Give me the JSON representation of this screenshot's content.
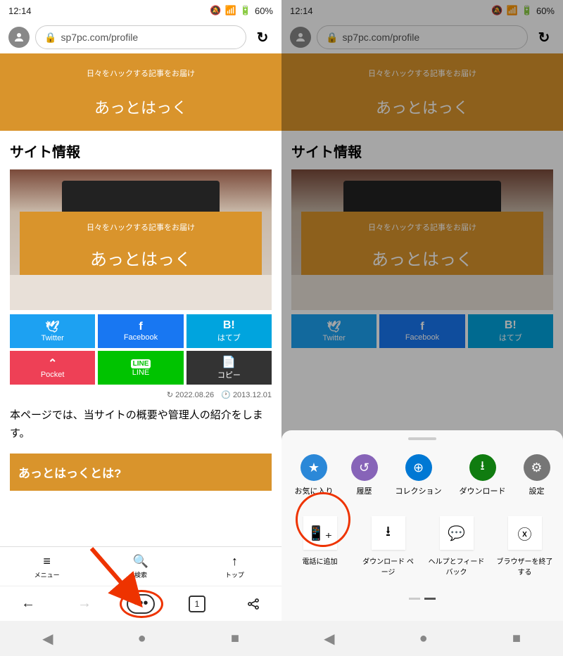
{
  "status": {
    "time": "12:14",
    "battery": "60%"
  },
  "url": "sp7pc.com/profile",
  "banner": {
    "sub": "日々をハックする記事をお届け",
    "title": "あっとはっく"
  },
  "section_title": "サイト情報",
  "hero": {
    "sub": "日々をハックする記事をお届け",
    "title": "あっとはっく"
  },
  "share": {
    "twitter": {
      "icon": "🐦",
      "label": "Twitter"
    },
    "facebook": {
      "icon": "f",
      "label": "Facebook"
    },
    "hatena": {
      "icon": "B!",
      "label": "はてブ"
    },
    "pocket": {
      "icon": "◣",
      "label": "Pocket"
    },
    "line": {
      "icon": "LINE",
      "label": "LINE"
    },
    "copy": {
      "icon": "📋",
      "label": "コピー"
    }
  },
  "dates": {
    "updated": "2022.08.26",
    "created": "2013.12.01"
  },
  "body_text": "本ページでは、当サイトの概要や管理人の紹介をします。",
  "heading": "あっとはっくとは?",
  "site_nav": {
    "menu": "メニュー",
    "search": "検索",
    "top": "トップ"
  },
  "browser": {
    "tabs": "1"
  },
  "sheet": {
    "row1": {
      "fav": "お気に入り",
      "history": "履歴",
      "collection": "コレクション",
      "download": "ダウンロード",
      "settings": "設定"
    },
    "row2": {
      "add_phone": "電話に追加",
      "dl_page": "ダウンロード ページ",
      "help": "ヘルプとフィードバック",
      "exit": "ブラウザーを終了する"
    }
  }
}
